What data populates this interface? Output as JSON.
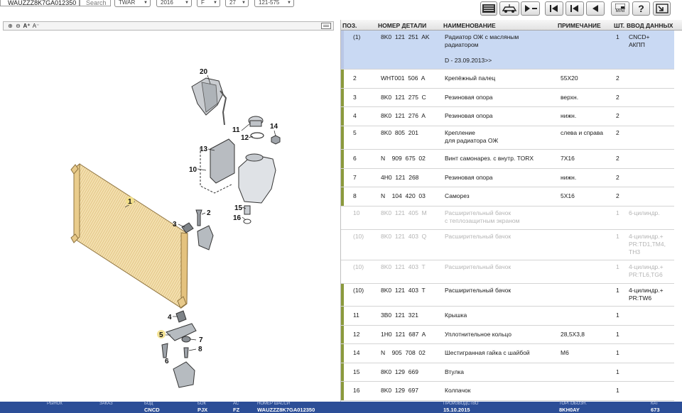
{
  "topbar": {
    "vin": "WAUZZZ8K7GA012350",
    "search_label": "Search",
    "combos": [
      "TWAR",
      "2016",
      "F",
      "27",
      "121-575"
    ],
    "buttons": [
      {
        "name": "list-view-icon"
      },
      {
        "name": "vehicle-icon"
      },
      {
        "name": "play-menu-icon"
      },
      {
        "name": "first-page-icon"
      },
      {
        "name": "previous-page-icon"
      },
      {
        "name": "back-icon"
      },
      {
        "name": "mini-view-icon",
        "label": "MINI"
      },
      {
        "name": "help-icon",
        "label": "?"
      },
      {
        "name": "export-icon"
      }
    ]
  },
  "diagram_toolbar": {
    "zoom_in": "⊕",
    "zoom_out": "⊖",
    "font_plus": "A⁺",
    "font_minus": "A⁻"
  },
  "diagram": {
    "callouts": [
      "1",
      "2",
      "3",
      "4",
      "5",
      "6",
      "7",
      "8",
      "10",
      "11",
      "12",
      "13",
      "14",
      "15",
      "16",
      "20"
    ]
  },
  "table": {
    "headers": {
      "pos": "ПОЗ.",
      "part_no": "НОМЕР ДЕТАЛИ",
      "name": "НАИМЕНОВАНИЕ",
      "note": "ПРИМЕЧАНИЕ",
      "qty": "ШТ.",
      "input": "ВВОД ДАННЫХ"
    },
    "rows": [
      {
        "pos": "(1)",
        "part": "8K0  121  251  AK",
        "name": "Радиатор ОЖ с масляным\nрадиатором\n\nD - 23.09.2013>>",
        "note": "",
        "qty": "1",
        "input": "CNCD+\nАКПП"
      },
      {
        "pos": "2",
        "part": "WHT001  506  A",
        "name": "Крепёжный палец",
        "note": "55X20",
        "qty": "2",
        "input": ""
      },
      {
        "pos": "3",
        "part": "8K0  121  275  C",
        "name": "Резиновая опора",
        "note": "верхн.",
        "qty": "2",
        "input": ""
      },
      {
        "pos": "4",
        "part": "8K0  121  276  A",
        "name": "Резиновая опора",
        "note": "нижн.",
        "qty": "2",
        "input": ""
      },
      {
        "pos": "5",
        "part": "8K0  805  201",
        "name": "Крепление\nдля радиатора ОЖ",
        "note": "слева и справа",
        "qty": "2",
        "input": ""
      },
      {
        "pos": "6",
        "part": "N    909  675  02",
        "name": "Винт самонарез. с внутр. TORX",
        "note": "7X16",
        "qty": "2",
        "input": ""
      },
      {
        "pos": "7",
        "part": "4H0  121  268",
        "name": "Резиновая опора",
        "note": "нижн.",
        "qty": "2",
        "input": ""
      },
      {
        "pos": "8",
        "part": "N    104  420  03",
        "name": "Саморез",
        "note": "5X16",
        "qty": "2",
        "input": ""
      },
      {
        "pos": "10",
        "part": "8K0  121  405  M",
        "name": "Расширительный бачок\nс теплозащитным экраном",
        "note": "",
        "qty": "1",
        "input": "6-цилиндр."
      },
      {
        "pos": "(10)",
        "part": "8K0  121  403  Q",
        "name": "Расширительный бачок",
        "note": "",
        "qty": "1",
        "input": "4-цилиндр.+\nPR:TD1,TM4,\nTH3"
      },
      {
        "pos": "(10)",
        "part": "8K0  121  403  T",
        "name": "Расширительный бачок",
        "note": "",
        "qty": "1",
        "input": "4-цилиндр.+\nPR:TL6,TG6"
      },
      {
        "pos": "(10)",
        "part": "8K0  121  403  T",
        "name": "Расширительный бачок",
        "note": "",
        "qty": "1",
        "input": "4-цилиндр.+\nPR:TW6"
      },
      {
        "pos": "11",
        "part": "3B0  121  321",
        "name": "Крышка",
        "note": "",
        "qty": "1",
        "input": ""
      },
      {
        "pos": "12",
        "part": "1H0  121  687  A",
        "name": "Уплотнительное кольцо",
        "note": "28,5X3,8",
        "qty": "1",
        "input": ""
      },
      {
        "pos": "14",
        "part": "N    905  708  02",
        "name": "Шестигранная гайка с шайбой",
        "note": "M6",
        "qty": "1",
        "input": ""
      },
      {
        "pos": "15",
        "part": "8K0  129  669",
        "name": "Втулка",
        "note": "",
        "qty": "1",
        "input": ""
      },
      {
        "pos": "16",
        "part": "8K0  129  697",
        "name": "Колпачок",
        "note": "",
        "qty": "1",
        "input": ""
      }
    ]
  },
  "statusbar": {
    "fields": [
      {
        "label": "РЫНОК",
        "value": ""
      },
      {
        "label": "ЗАКАЗ",
        "value": ""
      },
      {
        "label": "БОД",
        "value": "CNCD"
      },
      {
        "label": "БОК",
        "value": "PJX"
      },
      {
        "label": "АС",
        "value": "FZ"
      },
      {
        "label": "НОМЕР ШАССИ",
        "value": "WAUZZZ8K7GA012350"
      },
      {
        "label": "ПРОИЗВОДСТВО",
        "value": "15.10.2015"
      },
      {
        "label": "ТОРГ.ОБОЗН.",
        "value": "8KH0AY"
      },
      {
        "label": "КАТ",
        "value": "673"
      }
    ]
  },
  "colors": {
    "status_bar": "#2c4e97",
    "selected_row": "#c9d9f3",
    "row_marker_olive": "#8b9a3c",
    "row_marker_blue": "#b9c7e6"
  }
}
